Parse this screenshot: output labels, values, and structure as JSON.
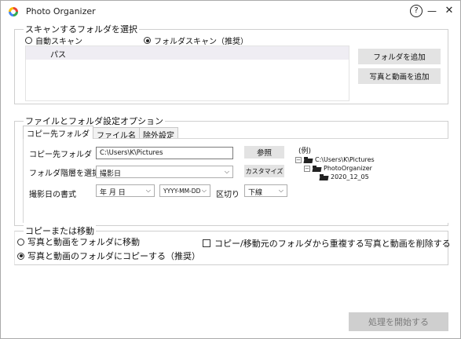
{
  "window": {
    "title": "Photo Organizer",
    "help": "?",
    "minimize": "—",
    "close": "✕"
  },
  "scan": {
    "legend": "スキャンするフォルダを選択",
    "auto_label": "自動スキャン",
    "folder_label": "フォルダスキャン（推奨）",
    "selected": "folder",
    "path_header": "パス",
    "add_folder": "フォルダを追加",
    "add_media": "写真と動画を追加"
  },
  "options": {
    "legend": "ファイルとフォルダ設定オプション",
    "tabs": [
      "コピー先フォルダ",
      "ファイル名",
      "除外設定"
    ],
    "active_tab": 0,
    "dest_label": "コピー先フォルダ",
    "dest_value": "C:\\Users\\K\\Pictures",
    "browse": "参照",
    "hierarchy_label": "フォルダ階層を選択",
    "hierarchy_value": "撮影日",
    "customize": "カスタマイズ",
    "date_format_label": "撮影日の書式",
    "date_part": "年 月 日",
    "date_pattern": "YYYY-MM-DD",
    "separator_label": "区切り",
    "separator_value": "下線",
    "example_label": "(例)",
    "tree": [
      "C:\\Users\\K\\Pictures",
      "PhotoOrganizer",
      "2020_12_05"
    ]
  },
  "copymove": {
    "legend": "コピーまたは移動",
    "move_label": "写真と動画をフォルダに移動",
    "copy_label": "写真と動画のフォルダにコピーする（推奨）",
    "selected": "copy",
    "delete_dup_label": "コピー/移動元のフォルダから重複する写真と動画を削除する"
  },
  "start": "処理を開始する",
  "colors": {
    "accent_blue": "#1a73e8",
    "logo": [
      "#e94235",
      "#fbbc05",
      "#34a853",
      "#4285f4"
    ]
  }
}
